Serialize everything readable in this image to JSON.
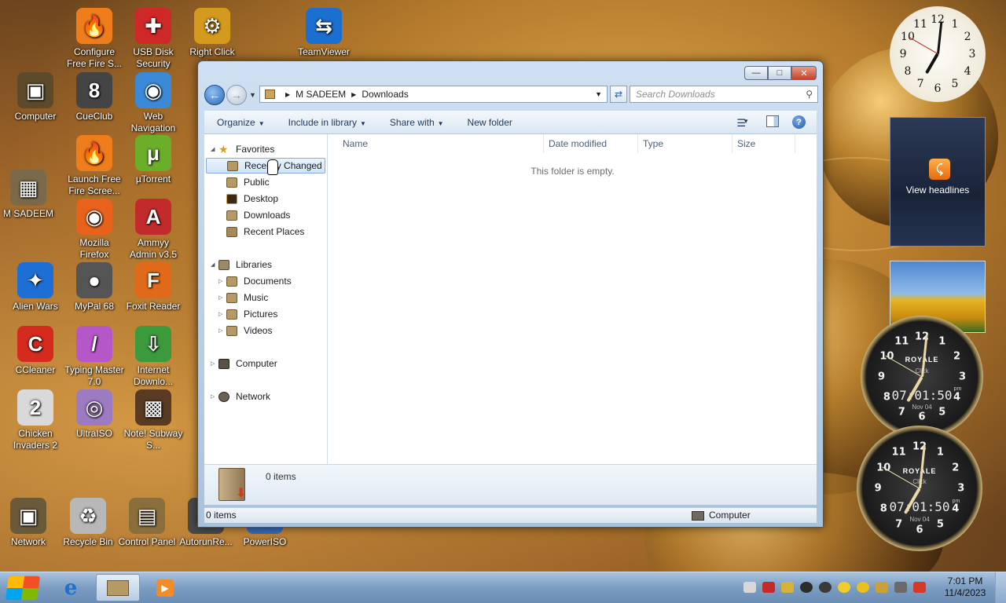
{
  "desktop": {
    "icons": [
      {
        "label": "Configure Free Fire S...",
        "icon": "flame-icon",
        "color": "#f07d1b"
      },
      {
        "label": "USB Disk Security",
        "icon": "shield-icon",
        "color": "#cf2828"
      },
      {
        "label": "Right Click Ir...",
        "icon": "gear-icon",
        "color": "#d49a1e"
      },
      {
        "label": "TeamViewer",
        "icon": "teamviewer-icon",
        "color": "#1a6fd1"
      },
      {
        "label": "Computer",
        "icon": "computer-icon",
        "color": "#5c4a2a"
      },
      {
        "label": "CueClub",
        "icon": "cue-ball-icon",
        "color": "#444444"
      },
      {
        "label": "Web Navigation",
        "icon": "globe-icon",
        "color": "#3a8ad8"
      },
      {
        "label": "Launch Free Fire Scree...",
        "icon": "flame-icon",
        "color": "#f07d1b"
      },
      {
        "label": "µTorrent",
        "icon": "utorrent-icon",
        "color": "#6aae2a"
      },
      {
        "label": "M SADEEM",
        "icon": "user-folder-icon",
        "color": "#7a6a4a"
      },
      {
        "label": "Mozilla Firefox",
        "icon": "firefox-icon",
        "color": "#e8621b"
      },
      {
        "label": "Ammyy Admin v3.5",
        "icon": "ammyy-icon",
        "color": "#c22b2b"
      },
      {
        "label": "Alien Wars",
        "icon": "alien-wars-icon",
        "color": "#1d6fd6"
      },
      {
        "label": "MyPal 68",
        "icon": "raccoon-icon",
        "color": "#555555"
      },
      {
        "label": "Foxit Reader",
        "icon": "foxit-icon",
        "color": "#e06a1a"
      },
      {
        "label": "CCleaner",
        "icon": "ccleaner-icon",
        "color": "#d52b1e"
      },
      {
        "label": "Typing Master 7.0",
        "icon": "typing-master-icon",
        "color": "#b556c9"
      },
      {
        "label": "Internet Downlo...",
        "icon": "download-manager-icon",
        "color": "#3b9a3b"
      },
      {
        "label": "Chicken Invaders 2",
        "icon": "chicken-icon",
        "color": "#d9d9d9"
      },
      {
        "label": "UltraISO",
        "icon": "disc-icon",
        "color": "#9c7bc2"
      },
      {
        "label": "Note! Subway S...",
        "icon": "subway-icon",
        "color": "#5a3a22"
      },
      {
        "label": "Network",
        "icon": "network-icon",
        "color": "#6b5a3a"
      },
      {
        "label": "Recycle Bin",
        "icon": "recycle-bin-icon",
        "color": "#b8b8b8"
      },
      {
        "label": "Control Panel",
        "icon": "control-panel-icon",
        "color": "#8a6e3c"
      },
      {
        "label": "AutorunRe...",
        "icon": "autorun-icon",
        "color": "#4a4a4a"
      },
      {
        "label": "PowerISO",
        "icon": "poweriso-icon",
        "color": "#3a6bb8"
      }
    ]
  },
  "explorer": {
    "address": {
      "root": "M SADEEM",
      "current": "Downloads"
    },
    "search_placeholder": "Search Downloads",
    "toolbar": {
      "organize": "Organize",
      "include_in_library": "Include in library",
      "share_with": "Share with",
      "new_folder": "New folder"
    },
    "nav": {
      "favorites": "Favorites",
      "favorites_items": [
        "Recently Changed",
        "Public",
        "Desktop",
        "Downloads",
        "Recent Places"
      ],
      "libraries": "Libraries",
      "libraries_items": [
        "Documents",
        "Music",
        "Pictures",
        "Videos"
      ],
      "computer": "Computer",
      "network": "Network"
    },
    "columns": [
      "Name",
      "Date modified",
      "Type",
      "Size"
    ],
    "empty_message": "This folder is empty.",
    "details_count": "0 items",
    "status_left": "0 items",
    "status_right": "Computer"
  },
  "gadgets": {
    "feed_label": "View headlines",
    "clock_brand": "ROYALE",
    "clock_sub": "Click",
    "digital_time": "07:01:50",
    "digital_date": "Nov 04",
    "digital_ampm": "pm"
  },
  "taskbar": {
    "time": "7:01 PM",
    "date": "11/4/2023"
  }
}
